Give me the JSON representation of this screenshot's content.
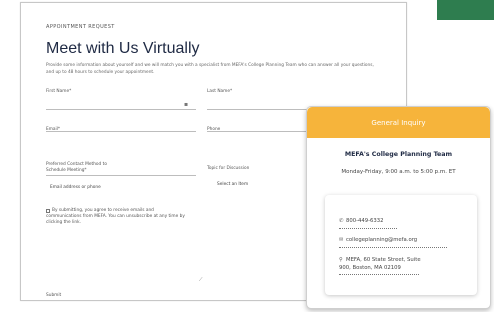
{
  "form": {
    "eyebrow": "APPOINTMENT REQUEST",
    "title": "Meet with Us Virtually",
    "intro_line1": "Provide some information about yourself and we will match you with a specialist from MEFA's College Planning Team who can",
    "intro_line2": "answer all your questions, and up to 48 hours to schedule your appointment.",
    "first_name_label": "First Name*",
    "last_name_label": "Last Name*",
    "email_label": "Email*",
    "phone_label": "Phone",
    "contact_method_label_1": "Preferred Contact Method to",
    "contact_method_label_2": "Schedule Meeting*",
    "contact_method_value": "Email address or phone",
    "topic_label": "Topic for Discussion",
    "topic_value": "Select an Item",
    "consent_line1": "By submitting, you agree to receive emails and",
    "consent_line2": "communications from MEFA. You can unsubscribe at any time by",
    "consent_line3": "clicking the link.",
    "submit_label": "Submit"
  },
  "inquiry": {
    "header": "General Inquiry",
    "team": "MEFA's College Planning Team",
    "hours": "Monday-Friday, 9:00 a.m. to 5:00 p.m. ET",
    "phone": "800-449-6332",
    "email": "collegeplanning@mefa.org",
    "address_line1": "MEFA, 60 State Street, Suite",
    "address_line2": "900, Boston, MA 02109"
  },
  "colors": {
    "accent_orange": "#f6b43b",
    "brand_navy": "#1f2a44",
    "green_band": "#2e7d4f"
  },
  "icons": {
    "phone": "phone-icon",
    "email": "envelope-icon",
    "address": "map-pin-icon"
  }
}
